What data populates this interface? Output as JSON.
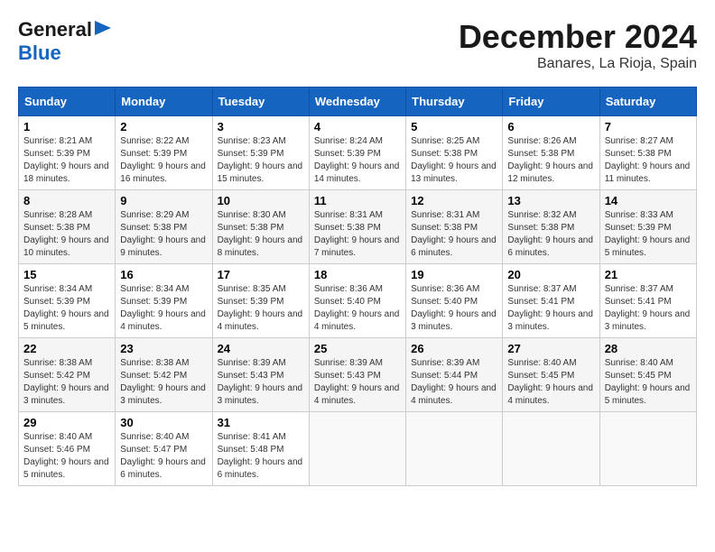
{
  "logo": {
    "line1": "General",
    "line2": "Blue"
  },
  "title": "December 2024",
  "subtitle": "Banares, La Rioja, Spain",
  "weekdays": [
    "Sunday",
    "Monday",
    "Tuesday",
    "Wednesday",
    "Thursday",
    "Friday",
    "Saturday"
  ],
  "weeks": [
    [
      {
        "day": "1",
        "info": "Sunrise: 8:21 AM\nSunset: 5:39 PM\nDaylight: 9 hours and 18 minutes."
      },
      {
        "day": "2",
        "info": "Sunrise: 8:22 AM\nSunset: 5:39 PM\nDaylight: 9 hours and 16 minutes."
      },
      {
        "day": "3",
        "info": "Sunrise: 8:23 AM\nSunset: 5:39 PM\nDaylight: 9 hours and 15 minutes."
      },
      {
        "day": "4",
        "info": "Sunrise: 8:24 AM\nSunset: 5:39 PM\nDaylight: 9 hours and 14 minutes."
      },
      {
        "day": "5",
        "info": "Sunrise: 8:25 AM\nSunset: 5:38 PM\nDaylight: 9 hours and 13 minutes."
      },
      {
        "day": "6",
        "info": "Sunrise: 8:26 AM\nSunset: 5:38 PM\nDaylight: 9 hours and 12 minutes."
      },
      {
        "day": "7",
        "info": "Sunrise: 8:27 AM\nSunset: 5:38 PM\nDaylight: 9 hours and 11 minutes."
      }
    ],
    [
      {
        "day": "8",
        "info": "Sunrise: 8:28 AM\nSunset: 5:38 PM\nDaylight: 9 hours and 10 minutes."
      },
      {
        "day": "9",
        "info": "Sunrise: 8:29 AM\nSunset: 5:38 PM\nDaylight: 9 hours and 9 minutes."
      },
      {
        "day": "10",
        "info": "Sunrise: 8:30 AM\nSunset: 5:38 PM\nDaylight: 9 hours and 8 minutes."
      },
      {
        "day": "11",
        "info": "Sunrise: 8:31 AM\nSunset: 5:38 PM\nDaylight: 9 hours and 7 minutes."
      },
      {
        "day": "12",
        "info": "Sunrise: 8:31 AM\nSunset: 5:38 PM\nDaylight: 9 hours and 6 minutes."
      },
      {
        "day": "13",
        "info": "Sunrise: 8:32 AM\nSunset: 5:38 PM\nDaylight: 9 hours and 6 minutes."
      },
      {
        "day": "14",
        "info": "Sunrise: 8:33 AM\nSunset: 5:39 PM\nDaylight: 9 hours and 5 minutes."
      }
    ],
    [
      {
        "day": "15",
        "info": "Sunrise: 8:34 AM\nSunset: 5:39 PM\nDaylight: 9 hours and 5 minutes."
      },
      {
        "day": "16",
        "info": "Sunrise: 8:34 AM\nSunset: 5:39 PM\nDaylight: 9 hours and 4 minutes."
      },
      {
        "day": "17",
        "info": "Sunrise: 8:35 AM\nSunset: 5:39 PM\nDaylight: 9 hours and 4 minutes."
      },
      {
        "day": "18",
        "info": "Sunrise: 8:36 AM\nSunset: 5:40 PM\nDaylight: 9 hours and 4 minutes."
      },
      {
        "day": "19",
        "info": "Sunrise: 8:36 AM\nSunset: 5:40 PM\nDaylight: 9 hours and 3 minutes."
      },
      {
        "day": "20",
        "info": "Sunrise: 8:37 AM\nSunset: 5:41 PM\nDaylight: 9 hours and 3 minutes."
      },
      {
        "day": "21",
        "info": "Sunrise: 8:37 AM\nSunset: 5:41 PM\nDaylight: 9 hours and 3 minutes."
      }
    ],
    [
      {
        "day": "22",
        "info": "Sunrise: 8:38 AM\nSunset: 5:42 PM\nDaylight: 9 hours and 3 minutes."
      },
      {
        "day": "23",
        "info": "Sunrise: 8:38 AM\nSunset: 5:42 PM\nDaylight: 9 hours and 3 minutes."
      },
      {
        "day": "24",
        "info": "Sunrise: 8:39 AM\nSunset: 5:43 PM\nDaylight: 9 hours and 3 minutes."
      },
      {
        "day": "25",
        "info": "Sunrise: 8:39 AM\nSunset: 5:43 PM\nDaylight: 9 hours and 4 minutes."
      },
      {
        "day": "26",
        "info": "Sunrise: 8:39 AM\nSunset: 5:44 PM\nDaylight: 9 hours and 4 minutes."
      },
      {
        "day": "27",
        "info": "Sunrise: 8:40 AM\nSunset: 5:45 PM\nDaylight: 9 hours and 4 minutes."
      },
      {
        "day": "28",
        "info": "Sunrise: 8:40 AM\nSunset: 5:45 PM\nDaylight: 9 hours and 5 minutes."
      }
    ],
    [
      {
        "day": "29",
        "info": "Sunrise: 8:40 AM\nSunset: 5:46 PM\nDaylight: 9 hours and 5 minutes."
      },
      {
        "day": "30",
        "info": "Sunrise: 8:40 AM\nSunset: 5:47 PM\nDaylight: 9 hours and 6 minutes."
      },
      {
        "day": "31",
        "info": "Sunrise: 8:41 AM\nSunset: 5:48 PM\nDaylight: 9 hours and 6 minutes."
      },
      null,
      null,
      null,
      null
    ]
  ]
}
